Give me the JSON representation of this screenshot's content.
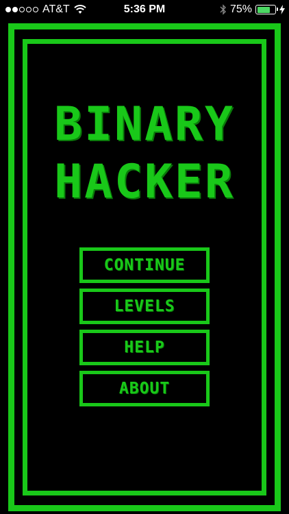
{
  "status_bar": {
    "carrier": "AT&T",
    "time": "5:36 PM",
    "battery_percent": "75%",
    "battery_level": 0.75,
    "signal_bars_filled": 2,
    "signal_bars_total": 5
  },
  "game": {
    "title_line1": "BINARY",
    "title_line2": "HACKER",
    "accent_color": "#19c819",
    "background_color": "#000000"
  },
  "menu": {
    "continue_label": "CONTINUE",
    "levels_label": "LEVELS",
    "help_label": "HELP",
    "about_label": "ABOUT"
  }
}
